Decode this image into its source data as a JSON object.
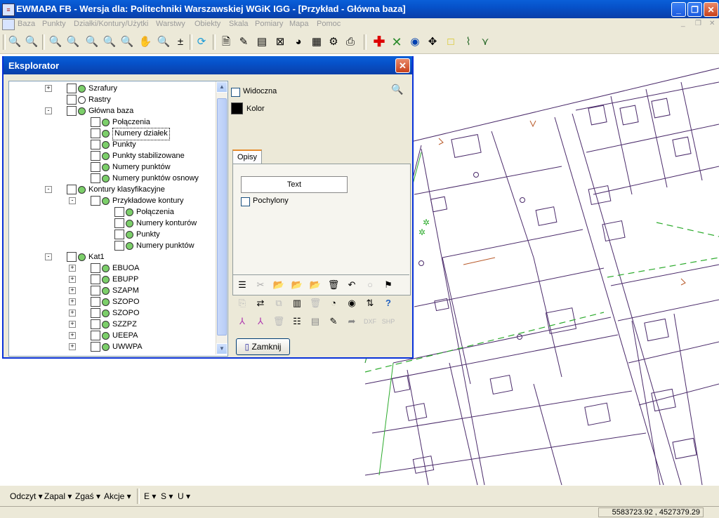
{
  "window": {
    "title": "EWMAPA FB - Wersja dla: Politechniki Warszawskiej WGiK IGG - [Przykład - Główna baza]"
  },
  "menu": [
    "Baza",
    "Punkty",
    "Działki/Kontury/Użytki",
    "Warstwy",
    "Obiekty",
    "Skala",
    "Pomiary",
    "Mapa",
    "Pomoc"
  ],
  "explorer": {
    "title": "Eksplorator",
    "tree": [
      {
        "label": "Szrafury",
        "level": 0,
        "expander": "+"
      },
      {
        "label": "Rastry",
        "level": 0,
        "expander": ""
      },
      {
        "label": "Główna baza",
        "level": 0,
        "expander": "-"
      },
      {
        "label": "Połączenia",
        "level": 1,
        "expander": ""
      },
      {
        "label": "Numery działek",
        "level": 1,
        "expander": "",
        "selected": true
      },
      {
        "label": "Punkty",
        "level": 1,
        "expander": ""
      },
      {
        "label": "Punkty stabilizowane",
        "level": 1,
        "expander": ""
      },
      {
        "label": "Numery punktów",
        "level": 1,
        "expander": ""
      },
      {
        "label": "Numery punktów osnowy",
        "level": 1,
        "expander": ""
      },
      {
        "label": "Kontury klasyfikacyjne",
        "level": 0,
        "expander": "-"
      },
      {
        "label": "Przykładowe kontury",
        "level": 1,
        "expander": "-"
      },
      {
        "label": "Połączenia",
        "level": 2,
        "expander": ""
      },
      {
        "label": "Numery konturów",
        "level": 2,
        "expander": ""
      },
      {
        "label": "Punkty",
        "level": 2,
        "expander": ""
      },
      {
        "label": "Numery punktów",
        "level": 2,
        "expander": ""
      },
      {
        "label": "Kat1",
        "level": 0,
        "expander": "-"
      },
      {
        "label": "EBUOA",
        "level": 1,
        "expander": "+"
      },
      {
        "label": "EBUPP",
        "level": 1,
        "expander": "+"
      },
      {
        "label": "SZAPM",
        "level": 1,
        "expander": "+"
      },
      {
        "label": "SZOPO",
        "level": 1,
        "expander": "+"
      },
      {
        "label": "SZOPO",
        "level": 1,
        "expander": "+"
      },
      {
        "label": "SZZPZ",
        "level": 1,
        "expander": "+"
      },
      {
        "label": "UEEPA",
        "level": 1,
        "expander": "+"
      },
      {
        "label": "UWWPA",
        "level": 1,
        "expander": "+"
      }
    ],
    "widoczna_label": "Widoczna",
    "kolor_label": "Kolor",
    "tab_label": "Opisy",
    "text_button": "Text",
    "pochylony_label": "Pochylony",
    "close_button": "Zamknij"
  },
  "status": {
    "buttons": [
      "Odczyt",
      "Zapal",
      "Zgaś",
      "Akcje",
      "E",
      "S",
      "U"
    ],
    "coordinates": "5583723.92 , 4527379.29"
  },
  "colors": {
    "titlebar": "#0651c9",
    "map_lines": "#4a2a6a",
    "map_green": "#2aaa2a"
  }
}
